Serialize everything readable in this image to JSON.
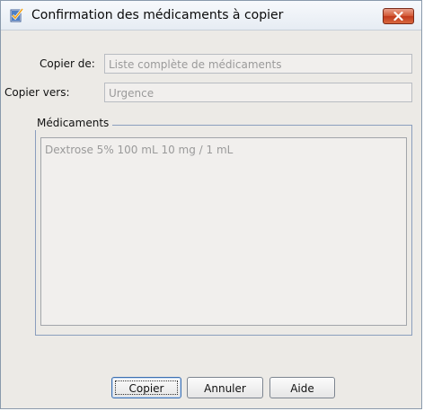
{
  "dialog": {
    "title": "Confirmation des médicaments à copier",
    "title_icon": "checkmark-document-icon",
    "close_icon": "close-icon"
  },
  "fields": {
    "copy_from": {
      "label": "Copier de:",
      "value": "Liste complète de médicaments"
    },
    "copy_to": {
      "label": "Copier vers:",
      "value": "Urgence"
    }
  },
  "medications": {
    "group_label": "Médicaments",
    "items": [
      "Dextrose 5%   100 mL 10 mg / 1 mL"
    ]
  },
  "buttons": {
    "copy": "Copier",
    "cancel": "Annuler",
    "help": "Aide"
  },
  "colors": {
    "close_button": "#c0391b",
    "group_border": "#8a9ebd",
    "window_background": "#eceae6"
  }
}
